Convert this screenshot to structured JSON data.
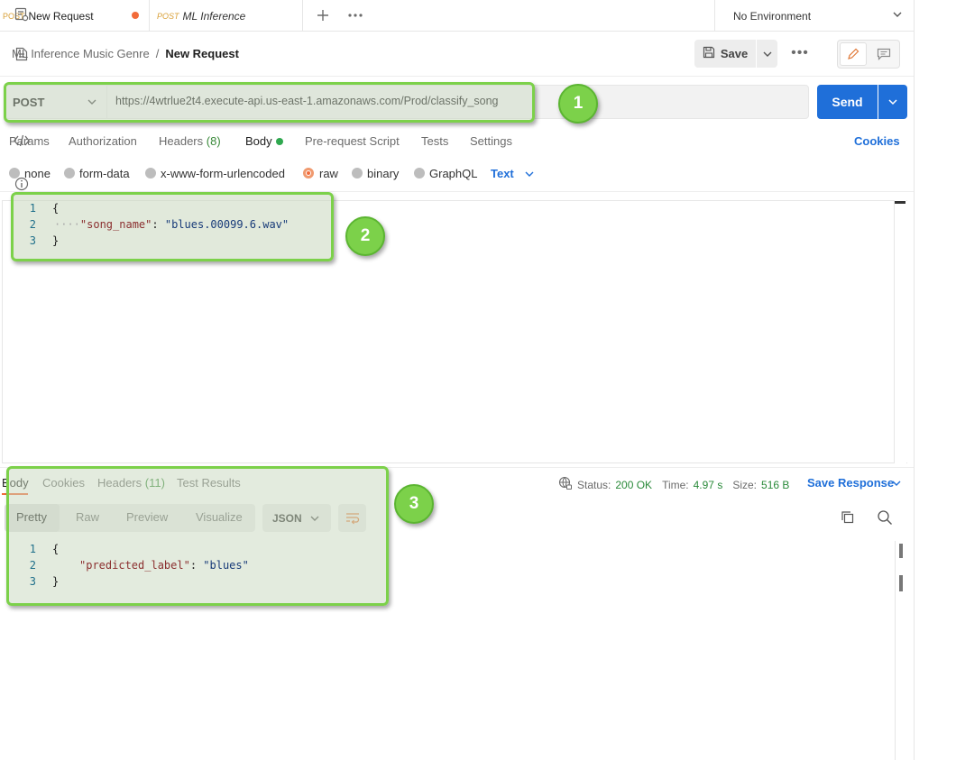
{
  "tabs": [
    {
      "method": "POST",
      "title": "New Request",
      "unsaved": true
    },
    {
      "method": "POST",
      "title": "ML Inference"
    }
  ],
  "environment": {
    "label": "No Environment"
  },
  "breadcrumb": {
    "collection": "ML Inference Music Genre",
    "separator": "/",
    "request": "New Request"
  },
  "toolbar": {
    "save_label": "Save",
    "more": "•••"
  },
  "request": {
    "method": "POST",
    "url": "https://4wtrlue2t4.execute-api.us-east-1.amazonaws.com/Prod/classify_song",
    "send_label": "Send"
  },
  "request_tabs": {
    "params": "Params",
    "authorization": "Authorization",
    "headers": "Headers",
    "headers_count": "(8)",
    "body": "Body",
    "prerequest": "Pre-request Script",
    "tests": "Tests",
    "settings": "Settings",
    "cookies": "Cookies"
  },
  "body_types": {
    "none": "none",
    "form_data": "form-data",
    "urlencoded": "x-www-form-urlencoded",
    "raw": "raw",
    "binary": "binary",
    "graphql": "GraphQL",
    "format": "Text",
    "selected": "raw"
  },
  "request_body": {
    "lines": [
      "1",
      "2",
      "3"
    ],
    "open": "{",
    "indent": "····",
    "key": "\"song_name\"",
    "colon": ": ",
    "value": "\"blues.00099.6.wav\"",
    "close": "}"
  },
  "response": {
    "tabs": {
      "body": "Body",
      "cookies": "Cookies",
      "headers": "Headers",
      "headers_count": "(11)",
      "test_results": "Test Results"
    },
    "status_label": "Status:",
    "status": "200 OK",
    "time_label": "Time:",
    "time": "4.97 s",
    "size_label": "Size:",
    "size": "516 B",
    "save_response": "Save Response",
    "views": {
      "pretty": "Pretty",
      "raw": "Raw",
      "preview": "Preview",
      "visualize": "Visualize"
    },
    "format": "JSON",
    "body": {
      "lines": [
        "1",
        "2",
        "3"
      ],
      "open": "{",
      "key": "\"predicted_label\"",
      "colon": ": ",
      "value": "\"blues\"",
      "close": "}"
    }
  },
  "annotations": {
    "one": "1",
    "two": "2",
    "three": "3"
  },
  "colors": {
    "accent_blue": "#1f6fd9",
    "status_green": "#2a8a3a",
    "highlight_green": "#7cd14a",
    "unsaved_dot": "#f26b3a"
  }
}
